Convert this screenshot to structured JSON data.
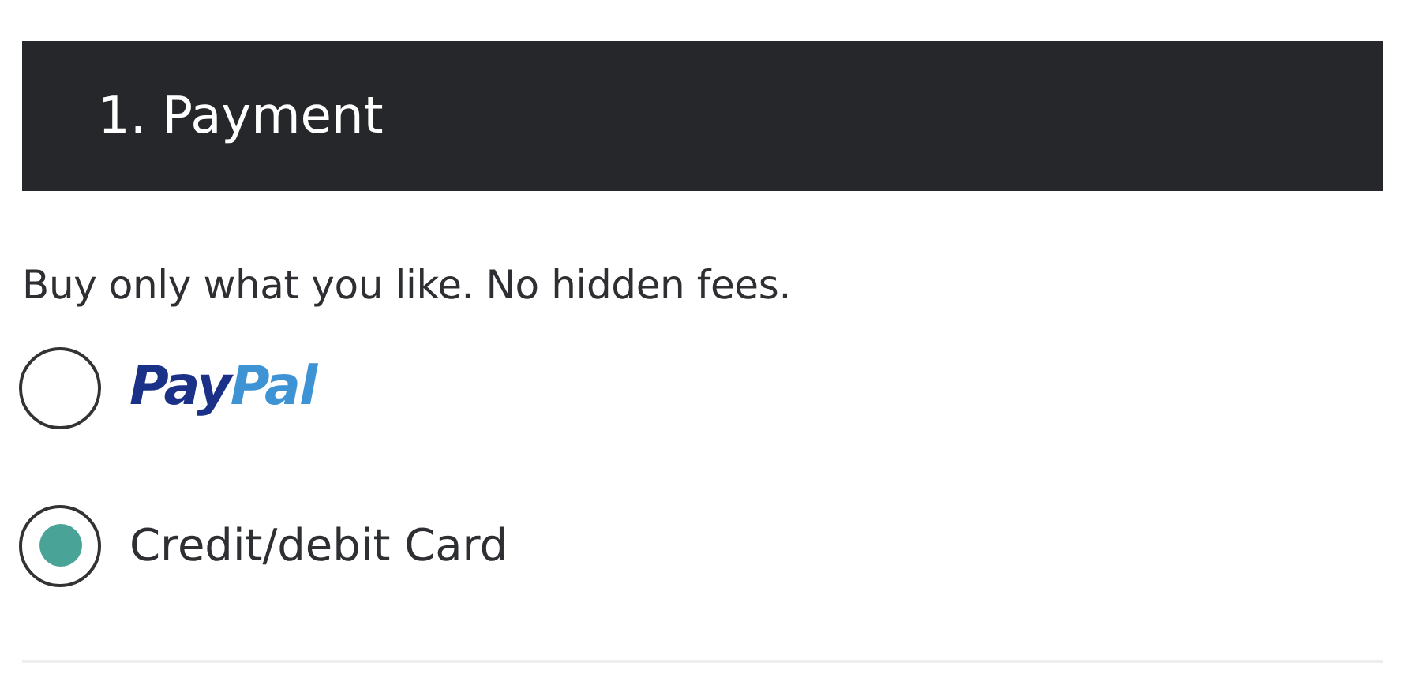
{
  "section": {
    "title": "1. Payment"
  },
  "note": "Buy only what you like. No hidden fees.",
  "options": [
    {
      "kind": "logo",
      "label_parts": [
        "Pay",
        "Pal"
      ],
      "selected": false
    },
    {
      "kind": "text",
      "label": "Credit/debit Card",
      "selected": true
    }
  ]
}
